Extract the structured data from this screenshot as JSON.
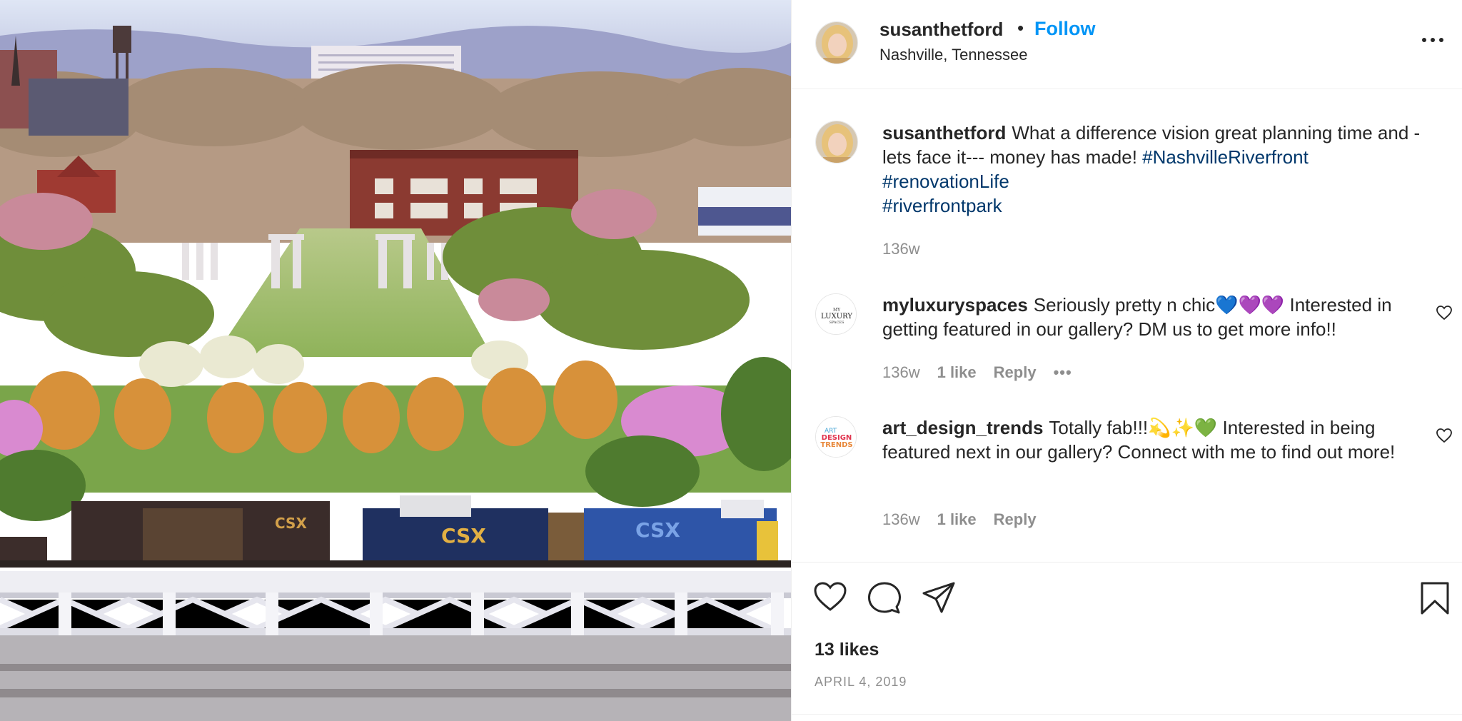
{
  "post": {
    "author": "susanthetford",
    "follow_label": "Follow",
    "separator": "•",
    "location": "Nashville, Tennessee",
    "more_label": "•••"
  },
  "caption": {
    "username": "susanthetford",
    "text": "What a difference vision great planning time and -lets face it--- money has made!",
    "hashtags": [
      "#NashvilleRiverfront",
      "#renovationLife",
      "#riverfrontpark"
    ],
    "age": "136w"
  },
  "comments": [
    {
      "username": "myluxuryspaces",
      "text": "Seriously pretty n chic💙💜💜 Interested in getting featured in our gallery? DM us to get more info!!",
      "avatar_lines": [
        "MY",
        "LUXURY",
        "SPACES"
      ],
      "age": "136w",
      "likes": "1 like",
      "reply_label": "Reply",
      "more_label": "•••"
    },
    {
      "username": "art_design_trends",
      "text": "Totally fab!!!💫✨💚 Interested in being featured next in our gallery? Connect with me to find out more!",
      "avatar_lines": [
        "ART",
        "DESIGN",
        "TRENDS"
      ],
      "age": "136w",
      "likes": "1 like",
      "reply_label": "Reply"
    }
  ],
  "stats": {
    "likes": "13 likes",
    "date": "APRIL 4, 2019"
  },
  "colors": {
    "link_blue": "#0095f6",
    "hashtag": "#00376b",
    "muted": "#8e8e8e",
    "text": "#262626",
    "divider": "#efefef"
  },
  "icons": [
    "heart-icon",
    "comment-icon",
    "share-icon",
    "bookmark-icon",
    "more-icon"
  ],
  "photo": {
    "train_label": "CSX"
  }
}
